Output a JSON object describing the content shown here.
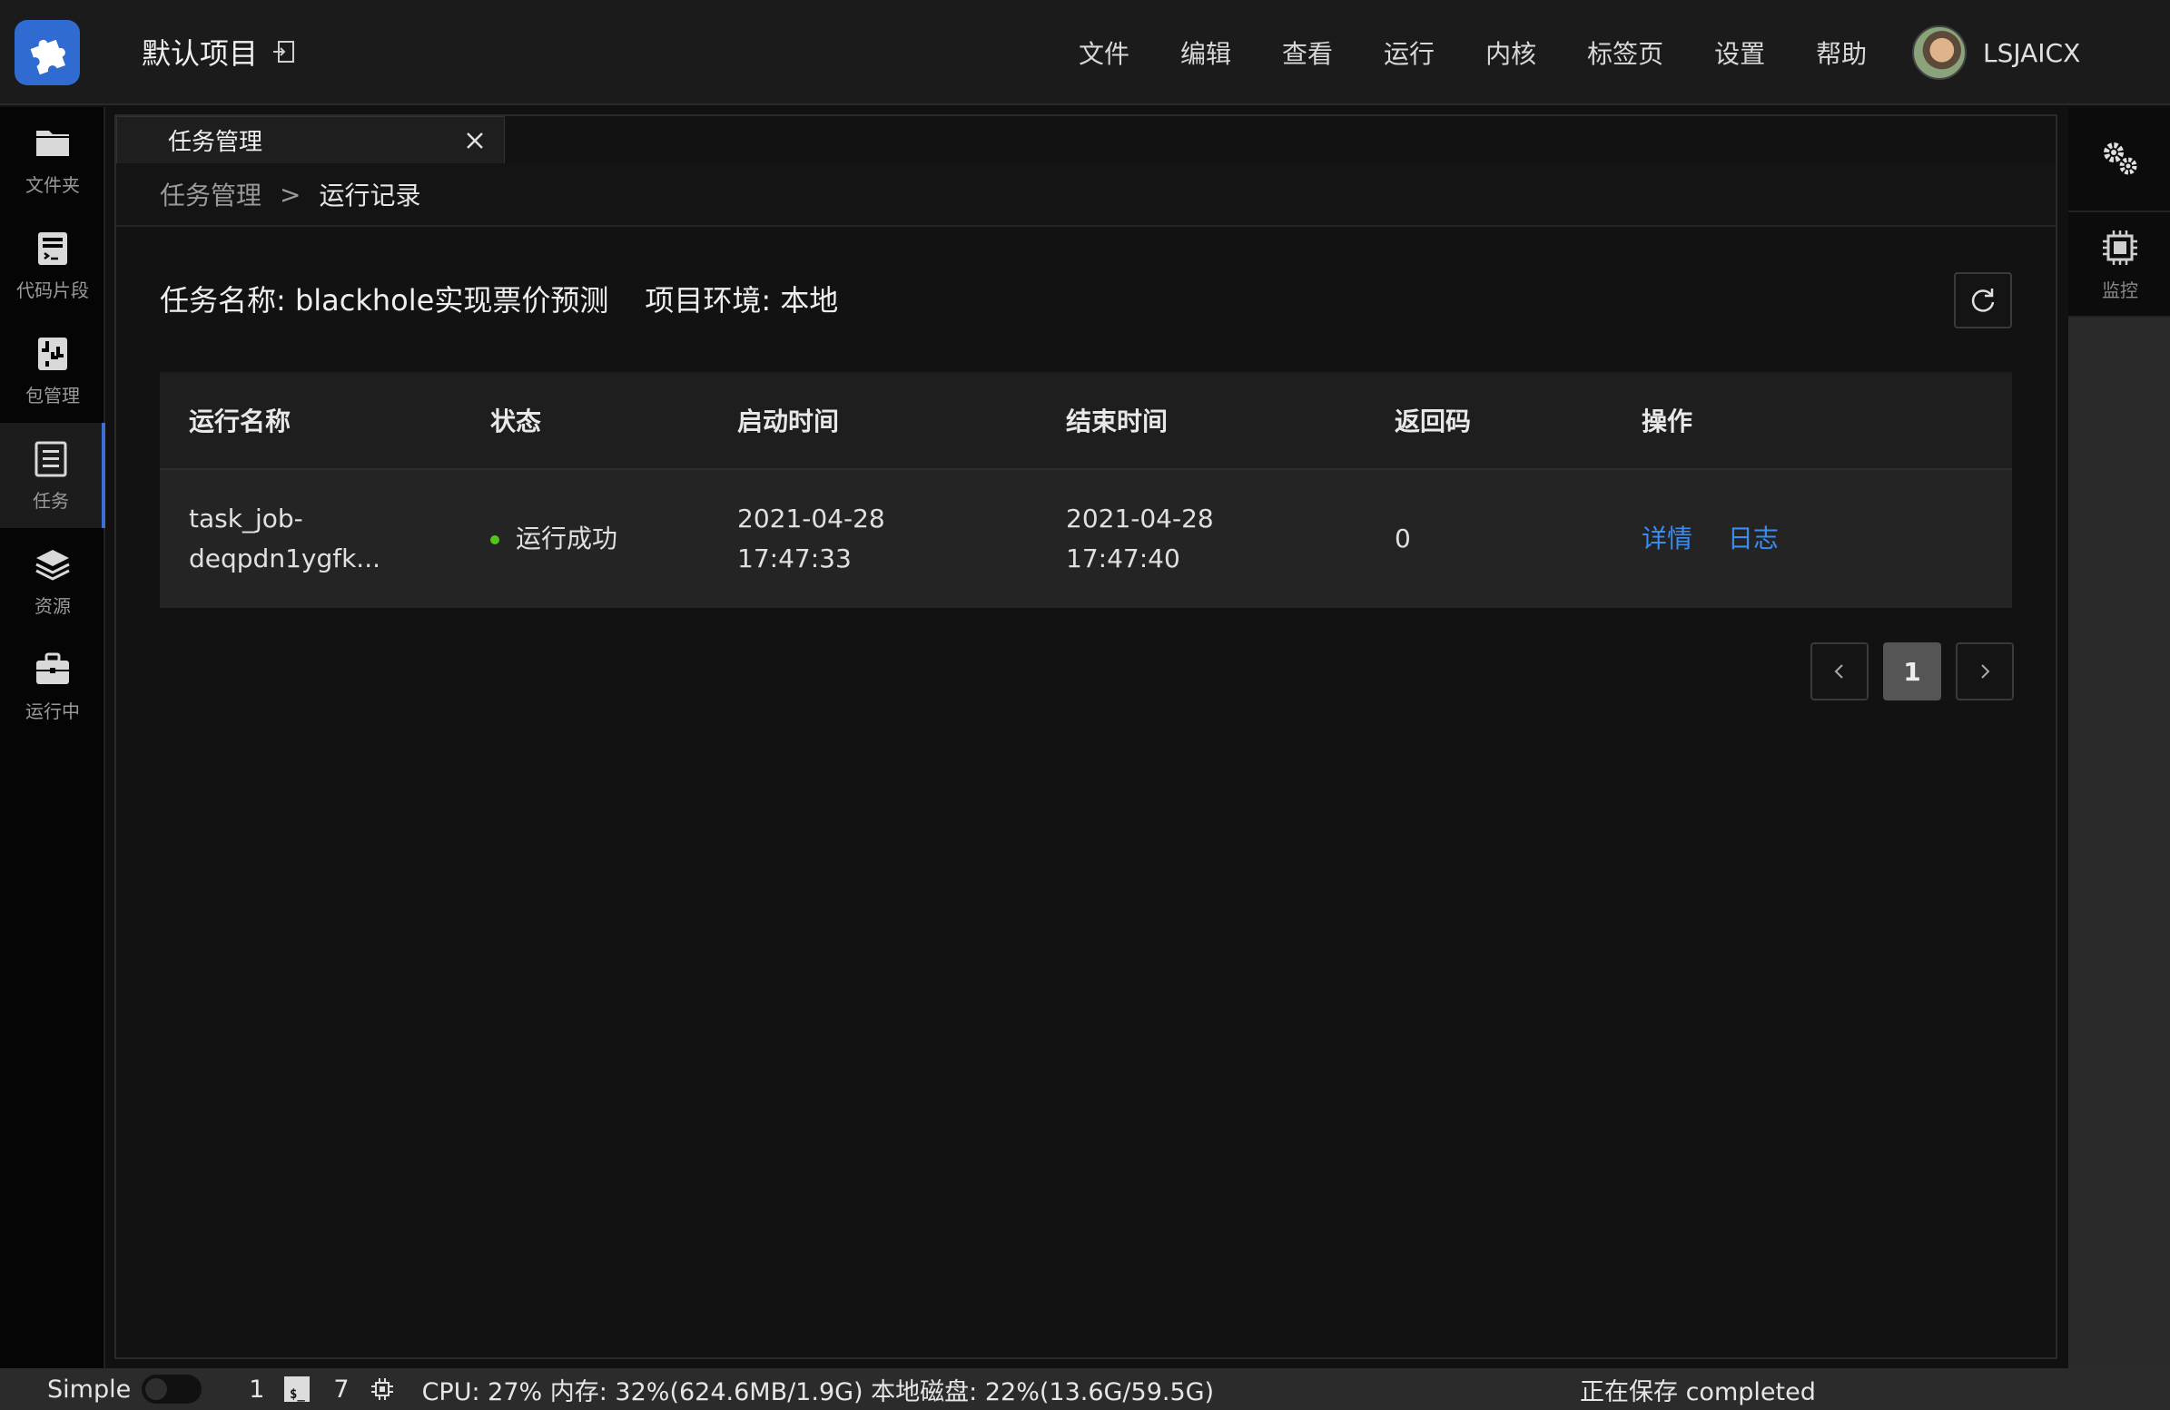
{
  "header": {
    "project_title": "默认项目",
    "menu": [
      "文件",
      "编辑",
      "查看",
      "运行",
      "内核",
      "标签页",
      "设置",
      "帮助"
    ],
    "username": "LSJAICX"
  },
  "sidebar": {
    "items": [
      {
        "label": "文件夹",
        "icon": "folder-icon"
      },
      {
        "label": "代码片段",
        "icon": "code-snippet-icon"
      },
      {
        "label": "包管理",
        "icon": "package-icon"
      },
      {
        "label": "任务",
        "icon": "task-icon",
        "active": true
      },
      {
        "label": "资源",
        "icon": "layers-icon"
      },
      {
        "label": "运行中",
        "icon": "briefcase-icon"
      }
    ]
  },
  "right_sidebar": {
    "items": [
      {
        "label": "",
        "icon": "gears-icon"
      },
      {
        "label": "监控",
        "icon": "chip-icon"
      }
    ]
  },
  "tab": {
    "label": "任务管理"
  },
  "breadcrumb": {
    "parent": "任务管理",
    "separator": ">",
    "current": "运行记录"
  },
  "info": {
    "task_name": "任务名称: blackhole实现票价预测",
    "environment": "项目环境: 本地"
  },
  "table": {
    "headers": [
      "运行名称",
      "状态",
      "启动时间",
      "结束时间",
      "返回码",
      "操作"
    ],
    "rows": [
      {
        "name": "task_job-deqpdn1ygfk...",
        "status": "运行成功",
        "status_color": "#52c41a",
        "start_date": "2021-04-28",
        "start_time": "17:47:33",
        "end_date": "2021-04-28",
        "end_time": "17:47:40",
        "code": "0",
        "actions": [
          "详情",
          "日志"
        ]
      }
    ]
  },
  "pagination": {
    "current": "1"
  },
  "statusbar": {
    "mode": "Simple",
    "terminals": "1",
    "terminal_icon_text": "$_",
    "kernels": "7",
    "stats": "CPU:  27% 内存:  32%(624.6MB/1.9G) 本地磁盘:  22%(13.6G/59.5G)",
    "save_status": "正在保存 completed"
  },
  "colors": {
    "accent": "#3b6fd4",
    "link": "#3b8cf0",
    "success": "#52c41a"
  }
}
